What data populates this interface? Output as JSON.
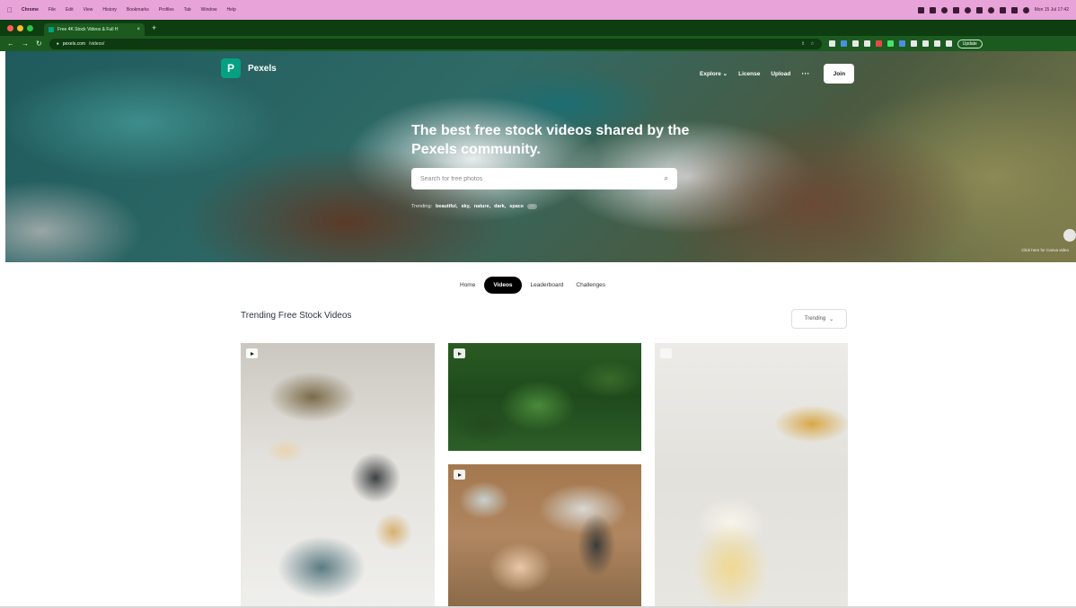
{
  "mac_menubar": {
    "app_name": "Chrome",
    "items": [
      "File",
      "Edit",
      "View",
      "History",
      "Bookmarks",
      "Profiles",
      "Tab",
      "Window",
      "Help"
    ],
    "clock": "Mon 15 Jul 17:42"
  },
  "browser": {
    "tab_title": "Free 4K Stock Videos & Full H",
    "url_domain": "pexels.com",
    "url_path": "/videos/",
    "update_label": "Update"
  },
  "hero": {
    "brand": "Pexels",
    "nav": {
      "explore": "Explore",
      "license": "License",
      "upload": "Upload",
      "more": "···",
      "join": "Join"
    },
    "title": "The best free stock videos shared by the Pexels community.",
    "search_placeholder": "Search for free photos",
    "trending_label": "Trending:",
    "trending_terms": [
      "beautiful,",
      "sky,",
      "nature,",
      "dark,",
      "space"
    ],
    "trending_more": "···",
    "credit": "Click here for Canva video"
  },
  "subnav": {
    "items": [
      "Home",
      "Videos",
      "Leaderboard",
      "Challenges"
    ],
    "active_index": 1
  },
  "section": {
    "title": "Trending Free Stock Videos",
    "sort_label": "Trending",
    "sort_chevron": "⌄"
  },
  "media": [
    {
      "name": "table-setting-dried-flowers",
      "type": "video"
    },
    {
      "name": "tropical-forest-palms",
      "type": "video"
    },
    {
      "name": "lighting-candle-table",
      "type": "video"
    },
    {
      "name": "beer-pouring-glass",
      "type": "video"
    }
  ],
  "colors": {
    "brand": "#05a081",
    "menubar": "#e8a3d8",
    "tabstrip": "#0e3d12",
    "active_tab": "#000000"
  }
}
